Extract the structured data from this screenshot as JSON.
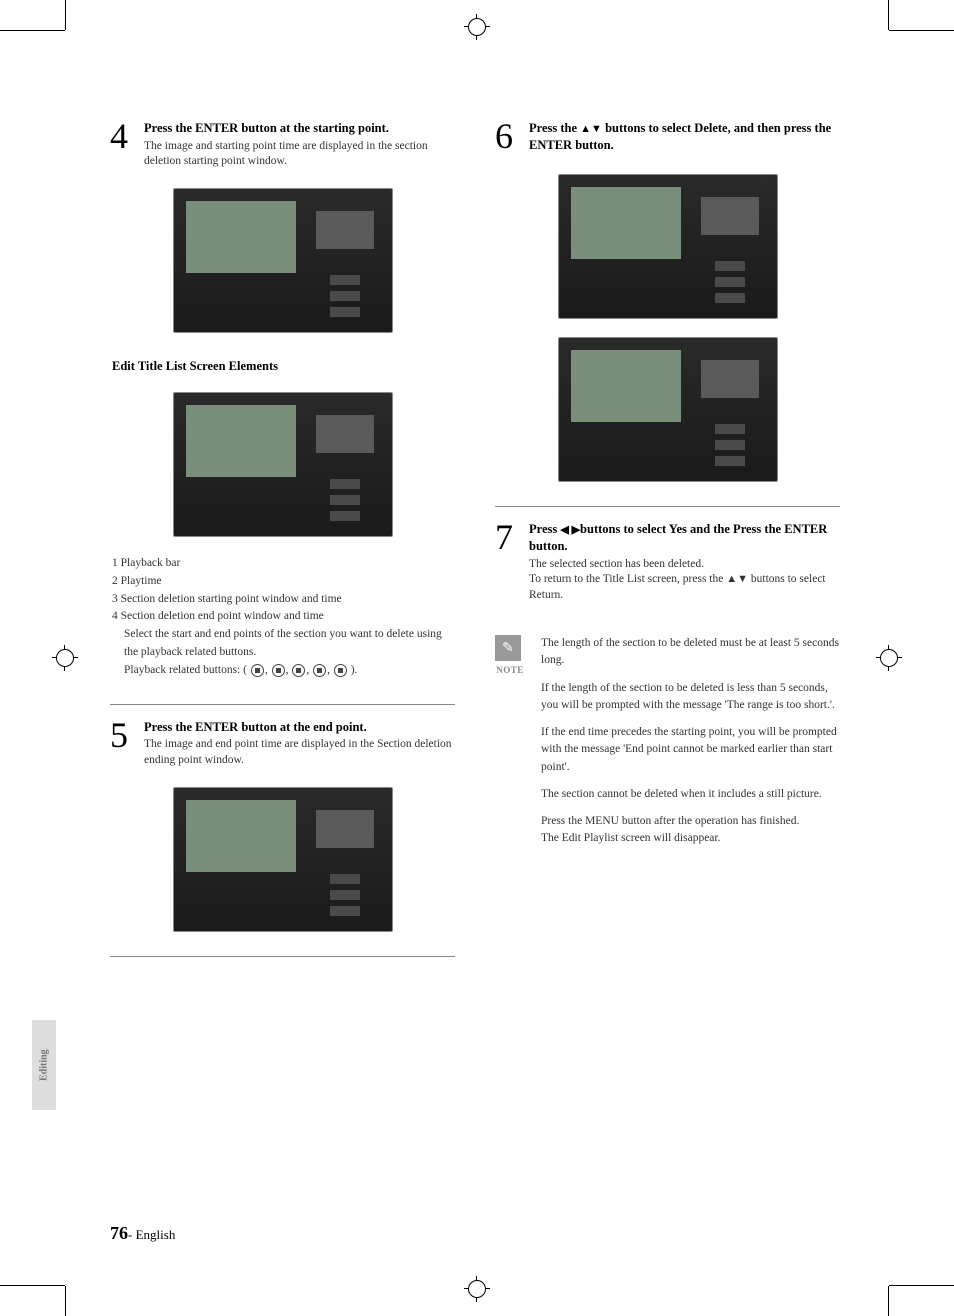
{
  "step4": {
    "num": "4",
    "title": "Press the ENTER button at the starting point.",
    "body1": "The image and starting point time are displayed in the section deletion starting point window."
  },
  "elements_heading": "Edit Title List Screen Elements",
  "legend": {
    "l1": "1 Playback bar",
    "l2": "2 Playtime",
    "l3": "3 Section deletion starting point window and time",
    "l4": "4 Section deletion end point window and time",
    "l5a": "Select the start and end points of the section you want to delete using the playback related buttons.",
    "l5b_prefix": "Playback related buttons: (",
    "l5b_suffix": ")."
  },
  "step5": {
    "num": "5",
    "title": "Press the ENTER button at the end point.",
    "body1": "The image and end point time are displayed in the Section deletion ending point window."
  },
  "step6": {
    "num": "6",
    "title_pre": "Press the ",
    "title_arrows": "▲▼",
    "title_post": " buttons to select Delete, and then press the ENTER button."
  },
  "step7": {
    "num": "7",
    "title_pre": "Press ",
    "title_arrows": "◀ ▶",
    "title_post": "buttons to select Yes and the Press the ENTER button.",
    "body1": "The selected section has been deleted.",
    "body2_pre": "To return to the Title List screen, press the ",
    "body2_arrows": "▲▼",
    "body2_post": " buttons to select Return."
  },
  "note": {
    "icon": "✎",
    "label": "NOTE",
    "p1": "The length of the section to be deleted must be at least 5 seconds long.",
    "p2": "If the length of the section to be deleted is less than 5 seconds, you will be prompted with the message 'The range is too short.'.",
    "p3": "If the end time precedes the starting point, you will be prompted with the message 'End point cannot be marked earlier than start point'.",
    "p4": "The section cannot be deleted when it includes a still picture.",
    "p5a": "Press the MENU button after the operation has finished.",
    "p5b": "The Edit Playlist screen will disappear."
  },
  "side_tab": "Editing",
  "footer": {
    "page": "76",
    "sep": "- ",
    "lang": "English"
  }
}
